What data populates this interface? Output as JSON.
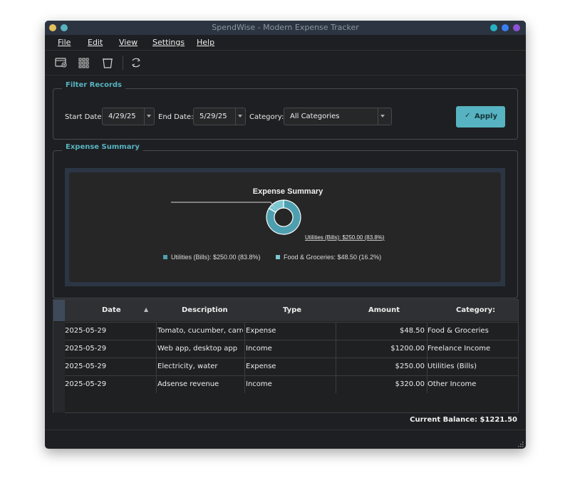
{
  "window": {
    "title": "SpendWise - Modern Expense Tracker",
    "colors": {
      "yellow": "#e2c05c",
      "teal": "#57b3c1",
      "cyan": "#27b0c4",
      "blue": "#3a7ef2",
      "purple": "#8c52d6"
    }
  },
  "menu": [
    "File",
    "Edit",
    "View",
    "Settings",
    "Help"
  ],
  "toolbar": {
    "icons": [
      "add-record-icon",
      "grid-icon",
      "delete-icon",
      "refresh-icon"
    ]
  },
  "filter": {
    "title": "Filter Records",
    "start_label": "Start Date:",
    "start_value": "4/29/25",
    "end_label": "End Date:",
    "end_value": "5/29/25",
    "category_label": "Category:",
    "category_value": "All Categories",
    "apply_label": "Apply"
  },
  "summary": {
    "title": "Expense Summary"
  },
  "chart_data": {
    "type": "pie",
    "title": "Expense Summary",
    "slices": [
      {
        "label": "Utilities (Bills)",
        "value": 250.0,
        "percent": 83.8,
        "color": "#4d9fb0"
      },
      {
        "label": "Food & Groceries",
        "value": 48.5,
        "percent": 16.2,
        "color": "#7ec6d2"
      }
    ],
    "slice_label": "Utilities (Bills): $250.00 (83.8%)",
    "legend": [
      "Utilities (Bills): $250.00 (83.8%)",
      "Food & Groceries: $48.50 (16.2%)"
    ]
  },
  "table": {
    "headers": [
      "Date",
      "Description",
      "Type",
      "Amount",
      "Category:"
    ],
    "rows": [
      [
        "2025-05-29",
        "Tomato, cucumber, carro…",
        "Expense",
        "$48.50",
        "Food & Groceries"
      ],
      [
        "2025-05-29",
        "Web app, desktop app",
        "Income",
        "$1200.00",
        "Freelance Income"
      ],
      [
        "2025-05-29",
        "Electricity, water",
        "Expense",
        "$250.00",
        "Utilities (Bills)"
      ],
      [
        "2025-05-29",
        "Adsense revenue",
        "Income",
        "$320.00",
        "Other Income"
      ]
    ]
  },
  "balance": "Current Balance: $1221.50"
}
